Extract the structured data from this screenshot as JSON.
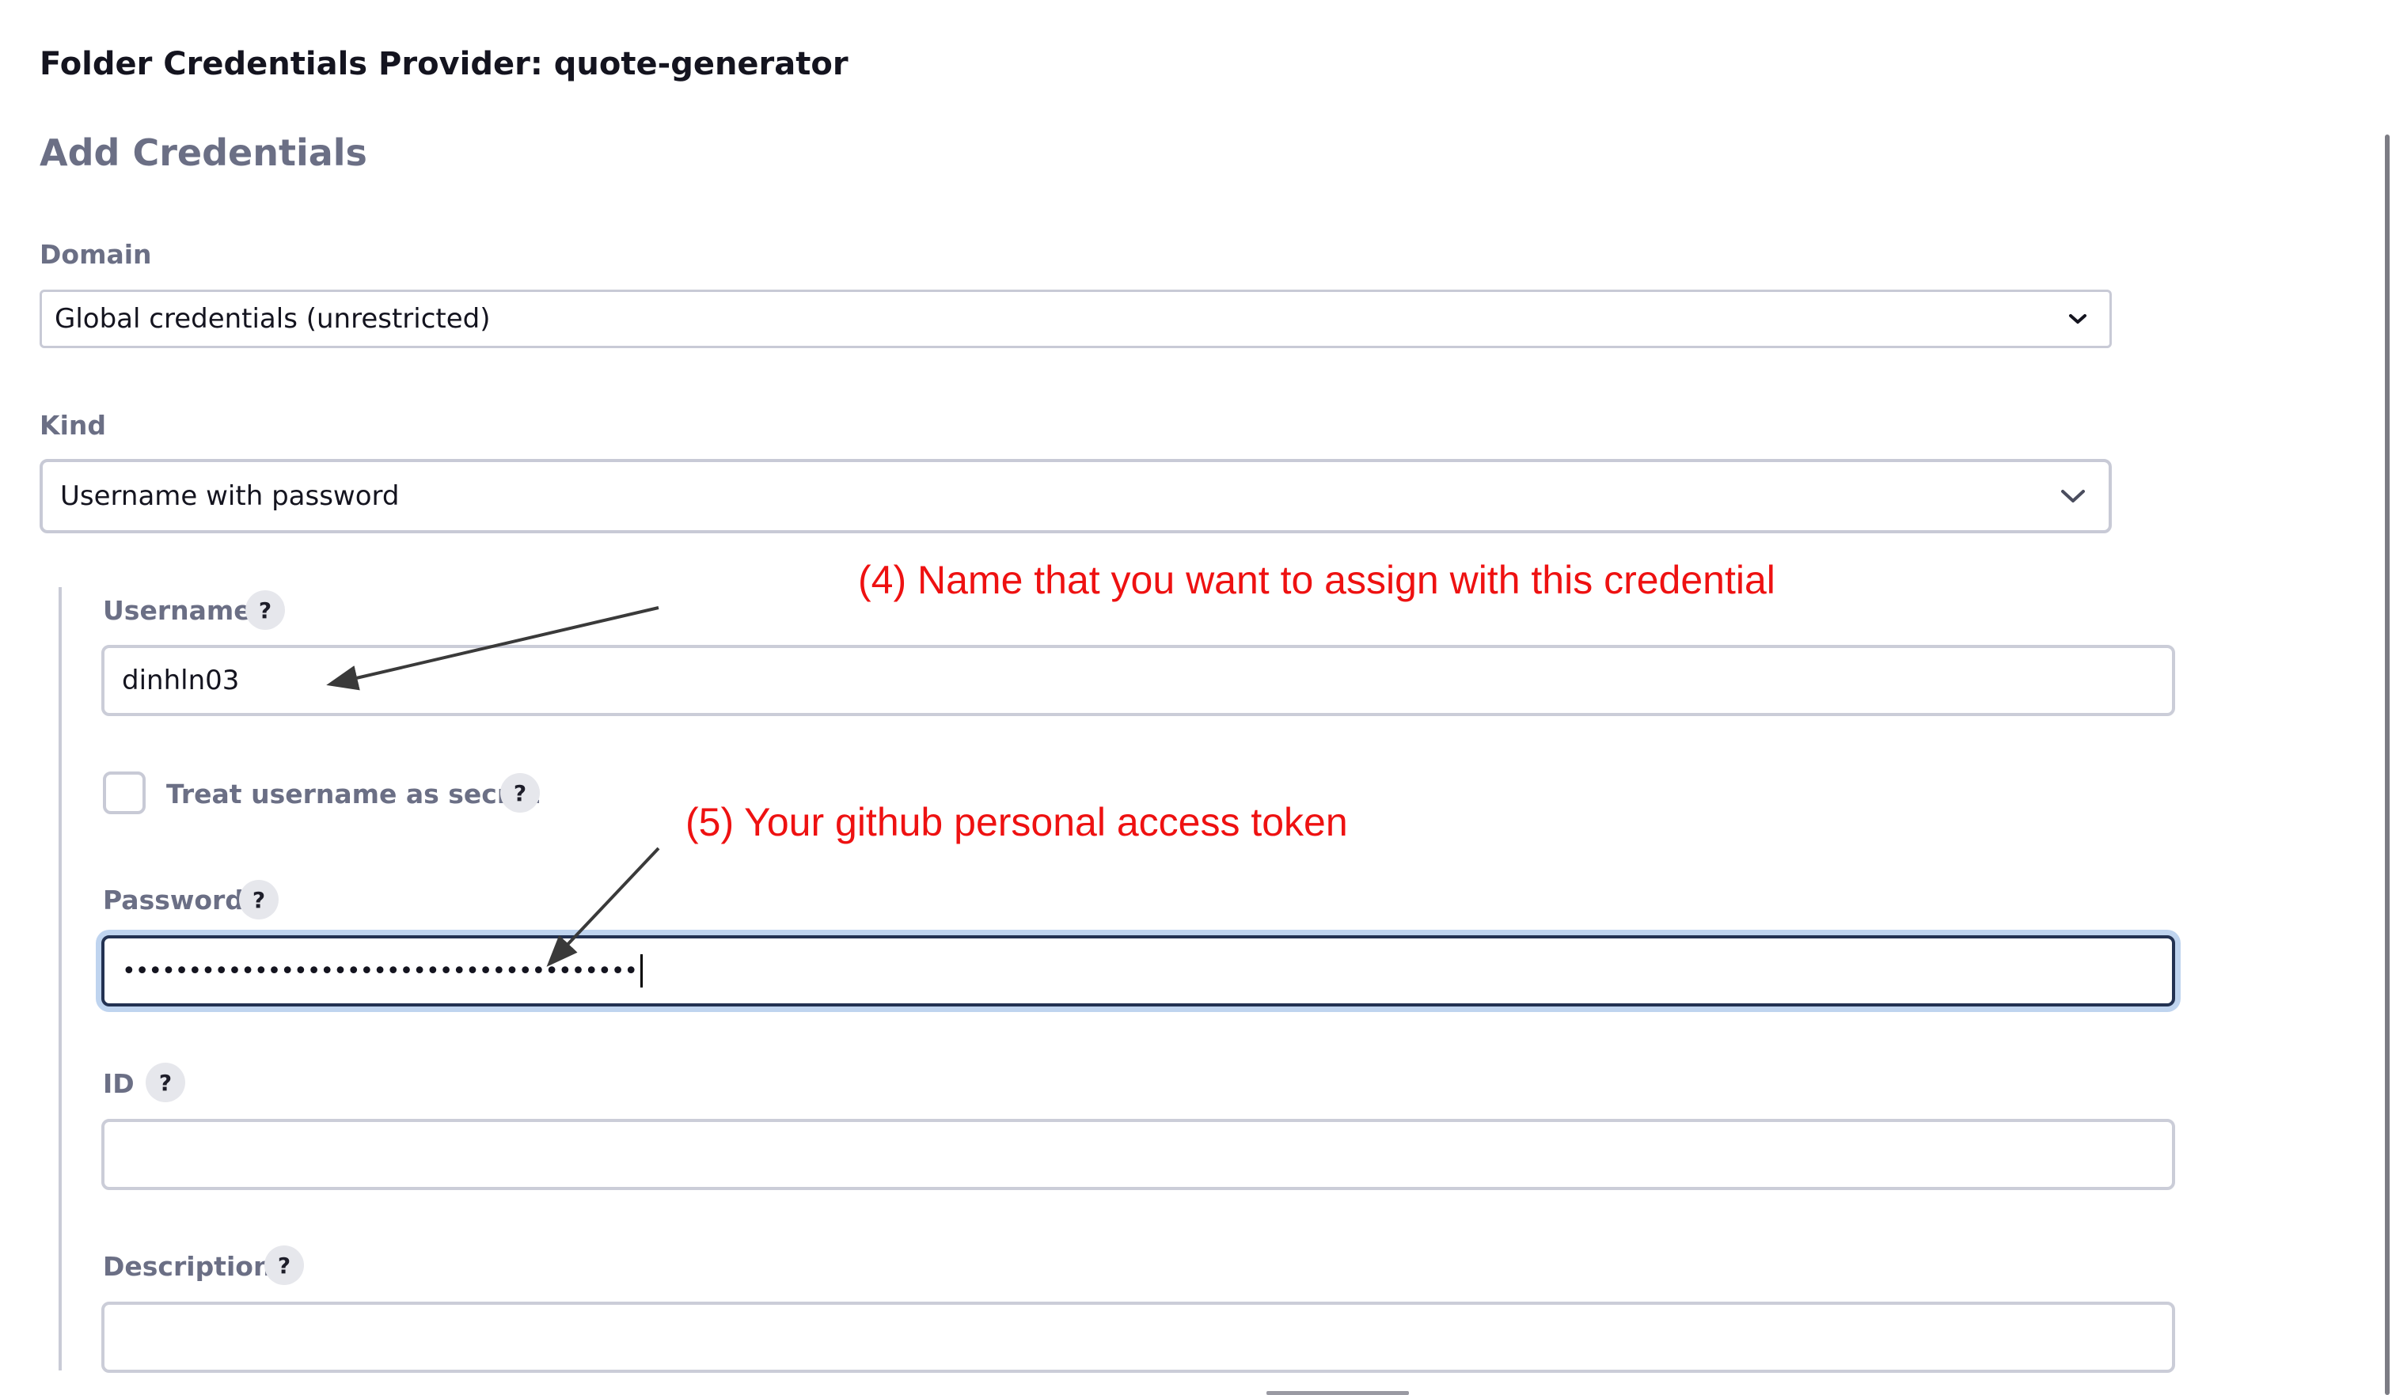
{
  "header": {
    "provider_title": "Folder Credentials Provider: quote-generator",
    "section_title": "Add Credentials"
  },
  "form": {
    "domain": {
      "label": "Domain",
      "value": "Global credentials (unrestricted)"
    },
    "kind": {
      "label": "Kind",
      "value": "Username with password"
    },
    "username": {
      "label": "Username",
      "value": "dinhln03",
      "help": "?"
    },
    "treat_secret": {
      "label": "Treat username as secret",
      "checked": false,
      "help": "?"
    },
    "password": {
      "label": "Password",
      "value": "•••••••••••••••••••••••••••••••••••••••",
      "help": "?"
    },
    "id": {
      "label": "ID",
      "value": "",
      "help": "?"
    },
    "description": {
      "label": "Description",
      "value": "",
      "help": "?"
    }
  },
  "annotations": {
    "step4": "(4)  Name that you want to assign with this credential",
    "step5": "(5)  Your github personal access token",
    "color": "#ee1111"
  },
  "colors": {
    "label": "#6b6f85",
    "focus_border": "#233252",
    "focus_ring": "#bfd4ef"
  }
}
